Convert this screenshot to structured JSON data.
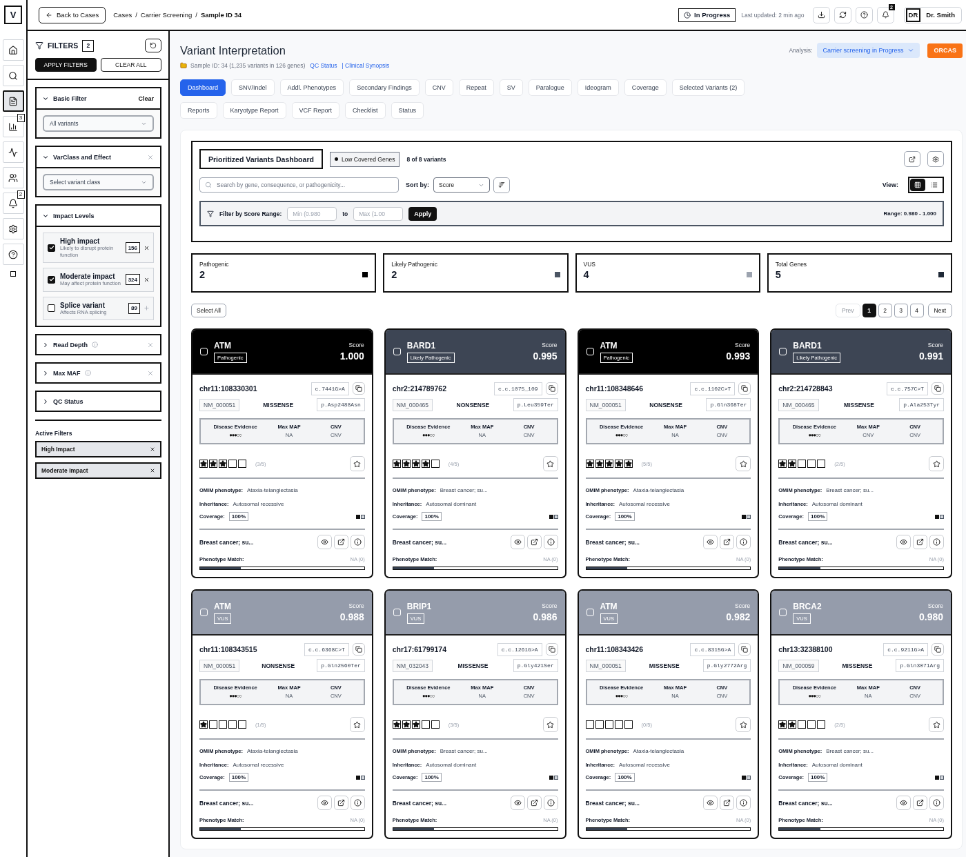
{
  "rail": {
    "logo": "V",
    "items": [
      {
        "kind": "home",
        "selected": false
      },
      {
        "kind": "search",
        "selected": false
      },
      {
        "kind": "document",
        "selected": true
      },
      {
        "kind": "chart",
        "selected": false,
        "badge": "3"
      },
      {
        "kind": "activity",
        "selected": false
      },
      {
        "kind": "users",
        "selected": false
      },
      {
        "kind": "bell",
        "selected": false,
        "badge": "2"
      },
      {
        "kind": "settings",
        "selected": false
      },
      {
        "kind": "help",
        "selected": false
      }
    ]
  },
  "topbar": {
    "back_button": "Back to Cases",
    "breadcrumb": [
      {
        "label": "Cases",
        "separator": "/",
        "current": false
      },
      {
        "label": "Carrier Screening",
        "separator": "/",
        "current": false
      },
      {
        "label": "Sample ID 34",
        "current": true
      }
    ],
    "status": "In Progress",
    "last_updated": "Last updated: 2 min ago",
    "actions": [
      {
        "kind": "download"
      },
      {
        "kind": "refresh"
      },
      {
        "kind": "help"
      },
      {
        "kind": "bell",
        "badge": "2"
      }
    ],
    "user": {
      "initials": "DR",
      "name": "Dr. Smith"
    }
  },
  "filters": {
    "title": "FILTERS",
    "count": "2",
    "apply": "APPLY FILTERS",
    "clear_all": "CLEAR ALL",
    "sections": [
      {
        "kind": "select",
        "title": "Basic Filter",
        "expanded": true,
        "info": false,
        "removable": false,
        "clear_label": "Clear",
        "value": "All variants"
      },
      {
        "kind": "select",
        "title": "VarClass and Effect",
        "expanded": true,
        "info": false,
        "removable": true,
        "value": "Select variant class"
      },
      {
        "kind": "checklist",
        "title": "Impact Levels",
        "expanded": true,
        "info": false,
        "removable": false,
        "options": [
          {
            "label": "High impact",
            "description": "Likely to disrupt protein function",
            "count": "156",
            "checked": true
          },
          {
            "label": "Moderate impact",
            "description": "May affect protein function",
            "count": "324",
            "checked": true
          },
          {
            "label": "Splice variant",
            "description": "Affects RNA splicing",
            "count": "89",
            "checked": false
          }
        ]
      },
      {
        "kind": "plain",
        "title": "Read Depth",
        "expanded": false,
        "info": true,
        "removable": true
      },
      {
        "kind": "plain",
        "title": "Max MAF",
        "expanded": false,
        "info": true,
        "removable": true
      },
      {
        "kind": "plain",
        "title": "QC Status",
        "expanded": false,
        "info": false,
        "removable": false
      }
    ],
    "active_title": "Active Filters",
    "active": [
      "High Impact",
      "Moderate Impact"
    ]
  },
  "main": {
    "title": "Variant Interpretation",
    "sample": "Sample ID: 34 (1,235 variants in 126 genes)",
    "links": [
      "QC Status",
      "| Clinical Synopsis"
    ],
    "analysis_label": "Analysis:",
    "analysis": "Carrier screening in Progress",
    "orcas": "ORCAS",
    "tab_rows": [
      [
        {
          "label": "Dashboard",
          "selected": true
        },
        {
          "label": "SNV/Indel",
          "selected": false
        },
        {
          "label": "Addl. Phenotypes",
          "selected": false
        },
        {
          "label": "Secondary Findings",
          "selected": false
        },
        {
          "label": "CNV",
          "selected": false
        },
        {
          "label": "Repeat",
          "selected": false
        },
        {
          "label": "SV",
          "selected": false
        },
        {
          "label": "Paralogue",
          "selected": false
        },
        {
          "label": "Ideogram",
          "selected": false
        },
        {
          "label": "Coverage",
          "selected": false
        },
        {
          "label": "Selected Variants (2)",
          "selected": false
        }
      ],
      [
        {
          "label": "Reports",
          "selected": false
        },
        {
          "label": "Karyotype Report",
          "selected": false
        },
        {
          "label": "VCF Report",
          "selected": false
        },
        {
          "label": "Checklist",
          "selected": false
        },
        {
          "label": "Status",
          "selected": false
        }
      ]
    ]
  },
  "dashboard": {
    "title": "Prioritized Variants Dashboard",
    "chip": "Low Covered Genes",
    "count": "8 of 8 variants",
    "search_placeholder": "Search by gene, consequence, or pathogenicity...",
    "sort_label": "Sort by:",
    "sort_value": "Score",
    "view_label": "View:",
    "views": [
      {
        "kind": "grid",
        "selected": true
      },
      {
        "kind": "list",
        "selected": false
      }
    ],
    "range": {
      "label": "Filter by Score Range:",
      "min_placeholder": "Min (0.980",
      "to": "to",
      "max_placeholder": "Max (1.00",
      "apply": "Apply",
      "summary": "Range: 0.980 - 1.000"
    },
    "stats": [
      {
        "label": "Pathogenic",
        "value": "2",
        "color": "#000000"
      },
      {
        "label": "Likely Pathogenic",
        "value": "2",
        "color": "#4b5563"
      },
      {
        "label": "VUS",
        "value": "4",
        "color": "#9ca3af"
      },
      {
        "label": "Total Genes",
        "value": "5",
        "color": "#1f2937"
      }
    ],
    "select_all": "Select All",
    "pagination": {
      "prev": "Prev",
      "prev_disabled": true,
      "pages": [
        {
          "label": "1",
          "selected": true
        },
        {
          "label": "2",
          "selected": false
        },
        {
          "label": "3",
          "selected": false
        },
        {
          "label": "4",
          "selected": false
        }
      ],
      "next": "Next"
    }
  },
  "variants": [
    {
      "gene": "ATM",
      "classification": "Pathogenic",
      "color": "#000000",
      "checked": false,
      "score_label": "Score",
      "score": "1.000",
      "position": "chr11:108330301",
      "cdna": "c.7441G>A",
      "transcript": "NM_000051",
      "consequence": "MISSENSE",
      "protein": "p.Asp2488Asn",
      "evidence_label": "Disease Evidence",
      "evidence": "●●●○○",
      "maf_label": "Max MAF",
      "maf": "NA",
      "cnv_label": "CNV",
      "cnv": "CNV",
      "stars": 3,
      "rating": "(3/5)",
      "omim_label": "OMIM phenotype:",
      "omim": "Ataxia-telangiectasia",
      "inheritance_label": "Inheritance:",
      "inheritance": "Autosomal recessive",
      "coverage_label": "Coverage:",
      "coverage": "100%",
      "phenotype": "Breast cancer; su...",
      "match_label": "Phenotype Match:",
      "match": "NA (0)",
      "level": 0.25
    },
    {
      "gene": "BARD1",
      "classification": "Likely Pathogenic",
      "color": "#3d4554",
      "checked": false,
      "score_label": "Score",
      "score": "0.995",
      "position": "chr2:214789762",
      "cdna": "c.c.1075_109",
      "transcript": "NM_000465",
      "consequence": "NONSENSE",
      "protein": "p.Leu359Ter",
      "evidence_label": "Disease Evidence",
      "evidence": "●●●○○",
      "maf_label": "Max MAF",
      "maf": "NA",
      "cnv_label": "CNV",
      "cnv": "CNV",
      "stars": 4,
      "rating": "(4/5)",
      "omim_label": "OMIM phenotype:",
      "omim": "Breast cancer; su...",
      "inheritance_label": "Inheritance:",
      "inheritance": "Autosomal dominant",
      "coverage_label": "Coverage:",
      "coverage": "100%",
      "phenotype": "Breast cancer; su...",
      "match_label": "Phenotype Match:",
      "match": "NA (0)",
      "level": 0.25
    },
    {
      "gene": "ATM",
      "classification": "Pathogenic",
      "color": "#000000",
      "checked": false,
      "score_label": "Score",
      "score": "0.993",
      "position": "chr11:108348646",
      "cdna": "c.c.1102C>T",
      "transcript": "NM_000051",
      "consequence": "NONSENSE",
      "protein": "p.Gln368Ter",
      "evidence_label": "Disease Evidence",
      "evidence": "●●●○○",
      "maf_label": "Max MAF",
      "maf": "NA",
      "cnv_label": "CNV",
      "cnv": "CNV",
      "stars": 5,
      "rating": "(5/5)",
      "omim_label": "OMIM phenotype:",
      "omim": "Ataxia-telangiectasia",
      "inheritance_label": "Inheritance:",
      "inheritance": "Autosomal recessive",
      "coverage_label": "Coverage:",
      "coverage": "100%",
      "phenotype": "Breast cancer; su...",
      "match_label": "Phenotype Match:",
      "match": "NA (0)",
      "level": 0.25
    },
    {
      "gene": "BARD1",
      "classification": "Likely Pathogenic",
      "color": "#3d4554",
      "checked": false,
      "score_label": "Score",
      "score": "0.991",
      "position": "chr2:214728843",
      "cdna": "c.c.757C>T",
      "transcript": "NM_000465",
      "consequence": "MISSENSE",
      "protein": "p.Ala253Tyr",
      "evidence_label": "Disease Evidence",
      "evidence": "●●●○○",
      "maf_label": "Max MAF",
      "maf": "CNV",
      "cnv_label": "CNV",
      "cnv": "CNV",
      "stars": 2,
      "rating": "(2/5)",
      "omim_label": "OMIM phenotype:",
      "omim": "Breast cancer; su...",
      "inheritance_label": "Inheritance:",
      "inheritance": "Autosomal dominant",
      "coverage_label": "Coverage:",
      "coverage": "100%",
      "phenotype": "Breast cancer; su...",
      "match_label": "Phenotype Match:",
      "match": "NA (0)",
      "level": 0.25
    },
    {
      "gene": "ATM",
      "classification": "VUS",
      "color": "#959cab",
      "checked": false,
      "score_label": "Score",
      "score": "0.988",
      "position": "chr11:108343515",
      "cdna": "c.c.6368C>T",
      "transcript": "NM_000051",
      "consequence": "NONSENSE",
      "protein": "p.Gln2560Ter",
      "evidence_label": "Disease Evidence",
      "evidence": "●●●○○",
      "maf_label": "Max MAF",
      "maf": "NA",
      "cnv_label": "CNV",
      "cnv": "CNV",
      "stars": 1,
      "rating": "(1/5)",
      "omim_label": "OMIM phenotype:",
      "omim": "Ataxia-telangiectasia",
      "inheritance_label": "Inheritance:",
      "inheritance": "Autosomal recessive",
      "coverage_label": "Coverage:",
      "coverage": "100%",
      "phenotype": "Breast cancer; su...",
      "match_label": "Phenotype Match:",
      "match": "NA (0)",
      "level": 0.25
    },
    {
      "gene": "BRIP1",
      "classification": "VUS",
      "color": "#959cab",
      "checked": false,
      "score_label": "Score",
      "score": "0.986",
      "position": "chr17:61799174",
      "cdna": "c.c.1261G>A",
      "transcript": "NM_032043",
      "consequence": "MISSENSE",
      "protein": "p.Gly421Ser",
      "evidence_label": "Disease Evidence",
      "evidence": "●●●○○",
      "maf_label": "Max MAF",
      "maf": "NA",
      "cnv_label": "CNV",
      "cnv": "CNV",
      "stars": 3,
      "rating": "(3/5)",
      "omim_label": "OMIM phenotype:",
      "omim": "Breast cancer; su...",
      "inheritance_label": "Inheritance:",
      "inheritance": "Autosomal dominant",
      "coverage_label": "Coverage:",
      "coverage": "100%",
      "phenotype": "Breast cancer; su...",
      "match_label": "Phenotype Match:",
      "match": "NA (0)",
      "level": 0.25
    },
    {
      "gene": "ATM",
      "classification": "VUS",
      "color": "#959cab",
      "checked": false,
      "score_label": "Score",
      "score": "0.982",
      "position": "chr11:108343426",
      "cdna": "c.c.8315G>A",
      "transcript": "NM_000051",
      "consequence": "MISSENSE",
      "protein": "p.Gly2772Arg",
      "evidence_label": "Disease Evidence",
      "evidence": "●●●○○",
      "maf_label": "Max MAF",
      "maf": "NA",
      "cnv_label": "CNV",
      "cnv": "CNV",
      "stars": 0,
      "rating": "(0/5)",
      "omim_label": "OMIM phenotype:",
      "omim": "Ataxia-telangiectasia",
      "inheritance_label": "Inheritance:",
      "inheritance": "Autosomal recessive",
      "coverage_label": "Coverage:",
      "coverage": "100%",
      "phenotype": "Breast cancer; su...",
      "match_label": "Phenotype Match:",
      "match": "NA (0)",
      "level": 0.25
    },
    {
      "gene": "BRCA2",
      "classification": "VUS",
      "color": "#959cab",
      "checked": false,
      "score_label": "Score",
      "score": "0.980",
      "position": "chr13:32388100",
      "cdna": "c.c.9211G>A",
      "transcript": "NM_000059",
      "consequence": "MISSENSE",
      "protein": "p.Gln3071Arg",
      "evidence_label": "Disease Evidence",
      "evidence": "●●●○○",
      "maf_label": "Max MAF",
      "maf": "NA",
      "cnv_label": "CNV",
      "cnv": "CNV",
      "stars": 2,
      "rating": "(2/5)",
      "omim_label": "OMIM phenotype:",
      "omim": "Breast cancer; su...",
      "inheritance_label": "Inheritance:",
      "inheritance": "Autosomal dominant",
      "coverage_label": "Coverage:",
      "coverage": "100%",
      "phenotype": "Breast cancer; su...",
      "match_label": "Phenotype Match:",
      "match": "NA (0)",
      "level": 0.25
    }
  ]
}
